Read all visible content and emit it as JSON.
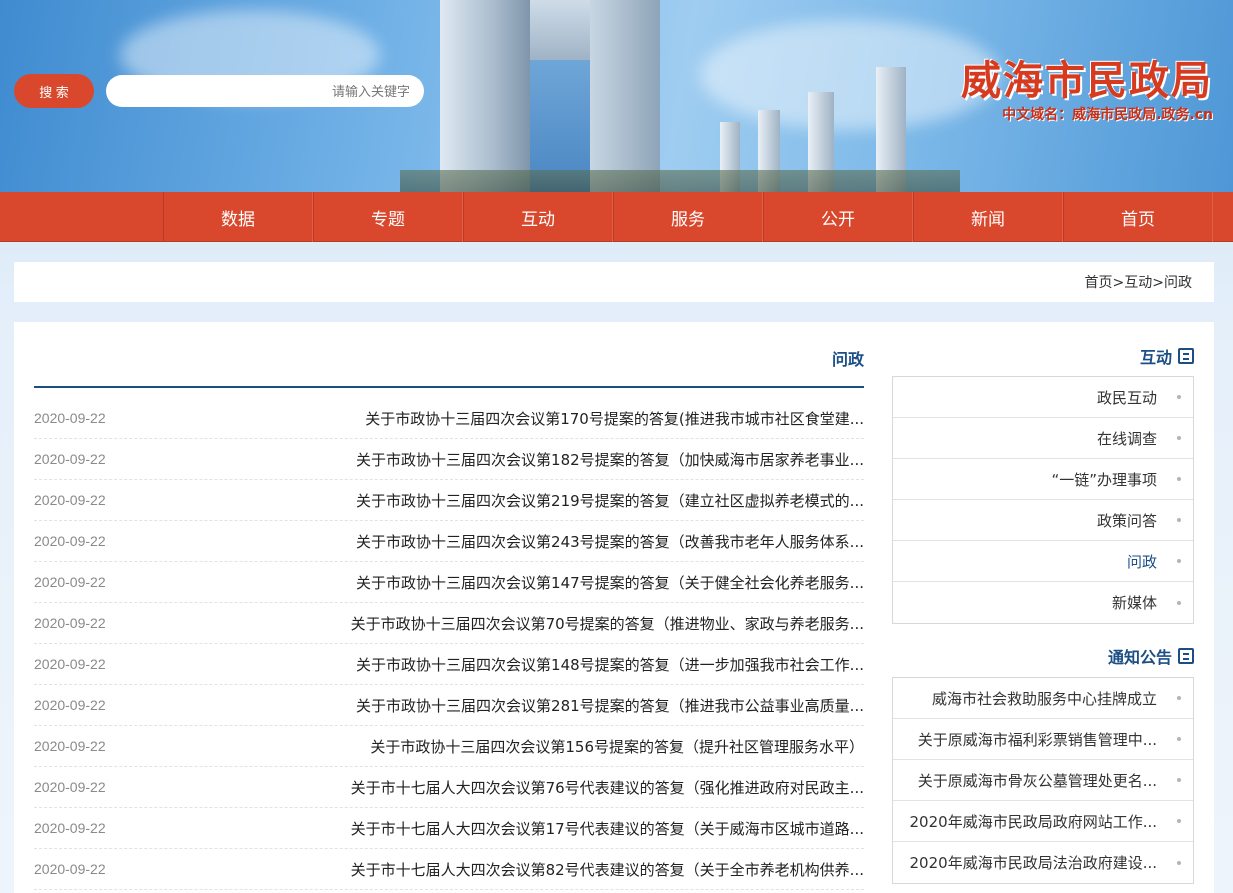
{
  "header": {
    "search_button_label": "搜 索",
    "search_placeholder": "请输入关键字",
    "logo_title": "威海市民政局",
    "domain_text": "中文域名：威海市民政局.政务.cn"
  },
  "nav": {
    "items": [
      "首页",
      "新闻",
      "公开",
      "服务",
      "互动",
      "专题",
      "数据"
    ]
  },
  "breadcrumb": "首页>互动>问政",
  "main": {
    "title": "问政",
    "articles": [
      {
        "title": "关于市政协十三届四次会议第170号提案的答复(推进我市城市社区食堂建...",
        "date": "2020-09-22"
      },
      {
        "title": "关于市政协十三届四次会议第182号提案的答复（加快威海市居家养老事业...",
        "date": "2020-09-22"
      },
      {
        "title": "关于市政协十三届四次会议第219号提案的答复（建立社区虚拟养老模式的...",
        "date": "2020-09-22"
      },
      {
        "title": "关于市政协十三届四次会议第243号提案的答复（改善我市老年人服务体系...",
        "date": "2020-09-22"
      },
      {
        "title": "关于市政协十三届四次会议第147号提案的答复（关于健全社会化养老服务...",
        "date": "2020-09-22"
      },
      {
        "title": "关于市政协十三届四次会议第70号提案的答复（推进物业、家政与养老服务...",
        "date": "2020-09-22"
      },
      {
        "title": "关于市政协十三届四次会议第148号提案的答复（进一步加强我市社会工作...",
        "date": "2020-09-22"
      },
      {
        "title": "关于市政协十三届四次会议第281号提案的答复（推进我市公益事业高质量...",
        "date": "2020-09-22"
      },
      {
        "title": "关于市政协十三届四次会议第156号提案的答复（提升社区管理服务水平）",
        "date": "2020-09-22"
      },
      {
        "title": "关于市十七届人大四次会议第76号代表建议的答复（强化推进政府对民政主...",
        "date": "2020-09-22"
      },
      {
        "title": "关于市十七届人大四次会议第17号代表建议的答复（关于威海市区城市道路...",
        "date": "2020-09-22"
      },
      {
        "title": "关于市十七届人大四次会议第82号代表建议的答复（关于全市养老机构供养...",
        "date": "2020-09-22"
      }
    ]
  },
  "sidebar": {
    "interaction_title": "互动",
    "interaction_items": [
      {
        "label": "政民互动"
      },
      {
        "label": "在线调查"
      },
      {
        "label": "“一链”办理事项"
      },
      {
        "label": "政策问答"
      },
      {
        "label": "问政",
        "active": true
      },
      {
        "label": "新媒体"
      }
    ],
    "notice_title": "通知公告",
    "notice_items": [
      {
        "label": "威海市社会救助服务中心挂牌成立"
      },
      {
        "label": "关于原威海市福利彩票销售管理中..."
      },
      {
        "label": "关于原威海市骨灰公墓管理处更名..."
      },
      {
        "label": "2020年威海市民政局政府网站工作..."
      },
      {
        "label": "2020年威海市民政局法治政府建设..."
      }
    ]
  },
  "colors": {
    "accent_red": "#d9482c",
    "accent_blue": "#1c4e86"
  }
}
